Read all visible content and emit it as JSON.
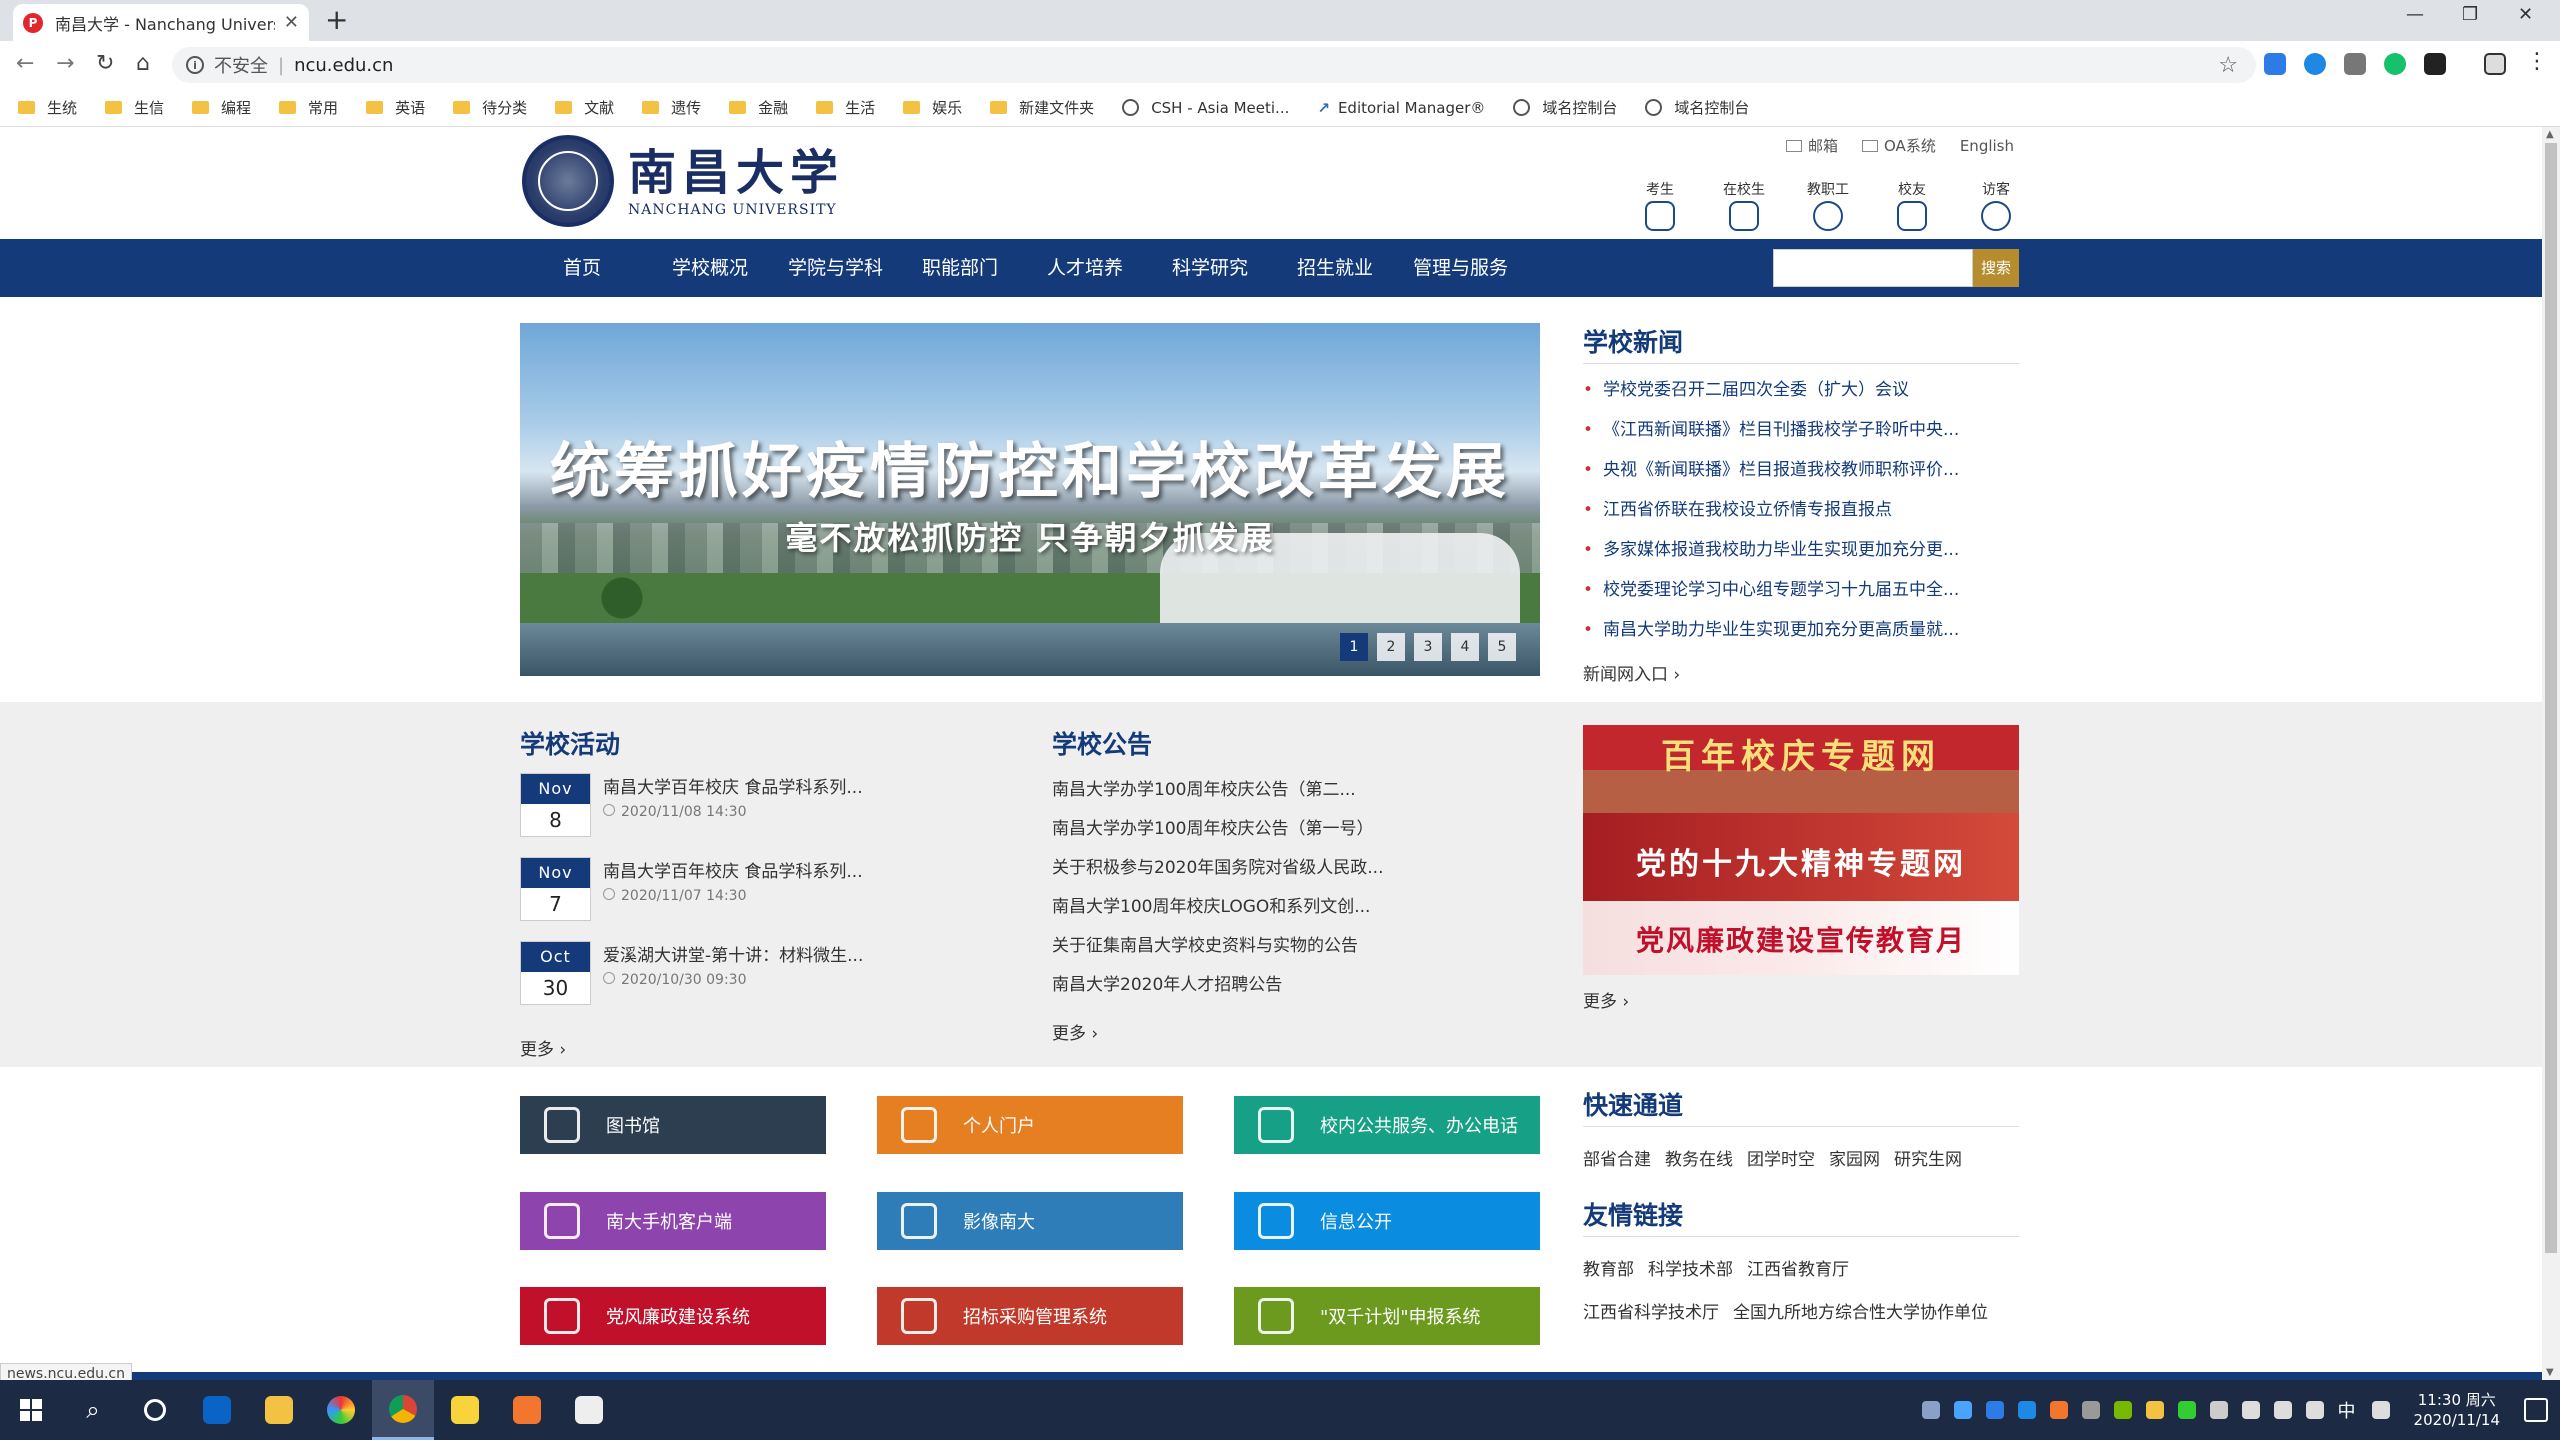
{
  "browser": {
    "tab_title": "南昌大学 - Nanchang University",
    "new_tab": "+",
    "insecure_label": "不安全",
    "url": "ncu.edu.cn",
    "bookmarks": [
      {
        "label": "生统",
        "type": "folder"
      },
      {
        "label": "生信",
        "type": "folder"
      },
      {
        "label": "编程",
        "type": "folder"
      },
      {
        "label": "常用",
        "type": "folder"
      },
      {
        "label": "英语",
        "type": "folder"
      },
      {
        "label": "待分类",
        "type": "folder"
      },
      {
        "label": "文献",
        "type": "folder"
      },
      {
        "label": "遗传",
        "type": "folder"
      },
      {
        "label": "金融",
        "type": "folder"
      },
      {
        "label": "生活",
        "type": "folder"
      },
      {
        "label": "娱乐",
        "type": "folder"
      },
      {
        "label": "新建文件夹",
        "type": "folder"
      },
      {
        "label": "CSH - Asia Meeti...",
        "type": "site"
      },
      {
        "label": "Editorial Manager®",
        "type": "em"
      },
      {
        "label": "域名控制台",
        "type": "site"
      },
      {
        "label": "域名控制台",
        "type": "site"
      }
    ]
  },
  "site": {
    "logo_cn": "南昌大学",
    "logo_en": "NANCHANG UNIVERSITY",
    "top_links": [
      "邮箱",
      "OA系统",
      "English"
    ],
    "roles": [
      "考生",
      "在校生",
      "教职工",
      "校友",
      "访客"
    ],
    "nav": [
      "首页",
      "学校概况",
      "学院与学科",
      "职能部门",
      "人才培养",
      "科学研究",
      "招生就业",
      "管理与服务"
    ],
    "search_button": "搜索",
    "banner": {
      "headline": "统筹抓好疫情防控和学校改革发展",
      "subline": "毫不放松抓防控 只争朝夕抓发展",
      "pages": [
        "1",
        "2",
        "3",
        "4",
        "5"
      ],
      "active_page": 1
    },
    "news": {
      "title": "学校新闻",
      "items": [
        "学校党委召开二届四次全委（扩大）会议",
        "《江西新闻联播》栏目刊播我校学子聆听中央...",
        "央视《新闻联播》栏目报道我校教师职称评价...",
        "江西省侨联在我校设立侨情专报直报点",
        "多家媒体报道我校助力毕业生实现更加充分更...",
        "校党委理论学习中心组专题学习十九届五中全...",
        "南昌大学助力毕业生实现更加充分更高质量就..."
      ],
      "more": "新闻网入口"
    },
    "activities": {
      "title": "学校活动",
      "items": [
        {
          "month": "Nov",
          "day": "8",
          "title": "南昌大学百年校庆 食品学科系列...",
          "time": "2020/11/08 14:30"
        },
        {
          "month": "Nov",
          "day": "7",
          "title": "南昌大学百年校庆 食品学科系列...",
          "time": "2020/11/07 14:30"
        },
        {
          "month": "Oct",
          "day": "30",
          "title": "爱溪湖大讲堂-第十讲：材料微生...",
          "time": "2020/10/30 09:30"
        }
      ],
      "more": "更多"
    },
    "notices": {
      "title": "学校公告",
      "items": [
        "南昌大学办学100周年校庆公告（第二...",
        "南昌大学办学100周年校庆公告（第一号）",
        "关于积极参与2020年国务院对省级人民政...",
        "南昌大学100周年校庆LOGO和系列文创...",
        "关于征集南昌大学校史资料与实物的公告",
        "南昌大学2020年人才招聘公告"
      ],
      "more": "更多"
    },
    "specials": {
      "items": [
        "百年校庆专题网",
        "党的十九大精神专题网",
        "党风廉政建设宣传教育月"
      ],
      "more": "更多"
    },
    "tiles": [
      {
        "label": "图书馆",
        "color": "#2c3e50",
        "icon": "book-icon"
      },
      {
        "label": "个人门户",
        "color": "#e67e22",
        "icon": "user-icon"
      },
      {
        "label": "校内公共服务、办公电话",
        "color": "#16a085",
        "icon": "phone-icon"
      },
      {
        "label": "南大手机客户端",
        "color": "#8e44ad",
        "icon": "mobile-icon"
      },
      {
        "label": "影像南大",
        "color": "#2e7cb8",
        "icon": "film-icon"
      },
      {
        "label": "信息公开",
        "color": "#0a8de0",
        "icon": "mail-icon"
      },
      {
        "label": "党风廉政建设系统",
        "color": "#c0102a",
        "icon": "flag-icon"
      },
      {
        "label": "招标采购管理系统",
        "color": "#c0392b",
        "icon": "pin-icon"
      },
      {
        "label": "\"双千计划\"申报系统",
        "color": "#6c9a1e",
        "icon": "building-icon"
      }
    ],
    "quick": {
      "title": "快速通道",
      "links": [
        "部省合建",
        "教务在线",
        "团学时空",
        "家园网",
        "研究生网"
      ]
    },
    "friends": {
      "title": "友情链接",
      "row1": [
        "教育部",
        "科学技术部",
        "江西省教育厅"
      ],
      "row2": [
        "江西省科学技术厅",
        "全国九所地方综合性大学协作单位"
      ]
    },
    "status_url": "news.ncu.edu.cn"
  },
  "taskbar": {
    "time": "11:30 周六",
    "date": "2020/11/14",
    "ime": "中"
  },
  "colors": {
    "brand_navy": "#143a7a",
    "accent_gold": "#b78c2f"
  }
}
